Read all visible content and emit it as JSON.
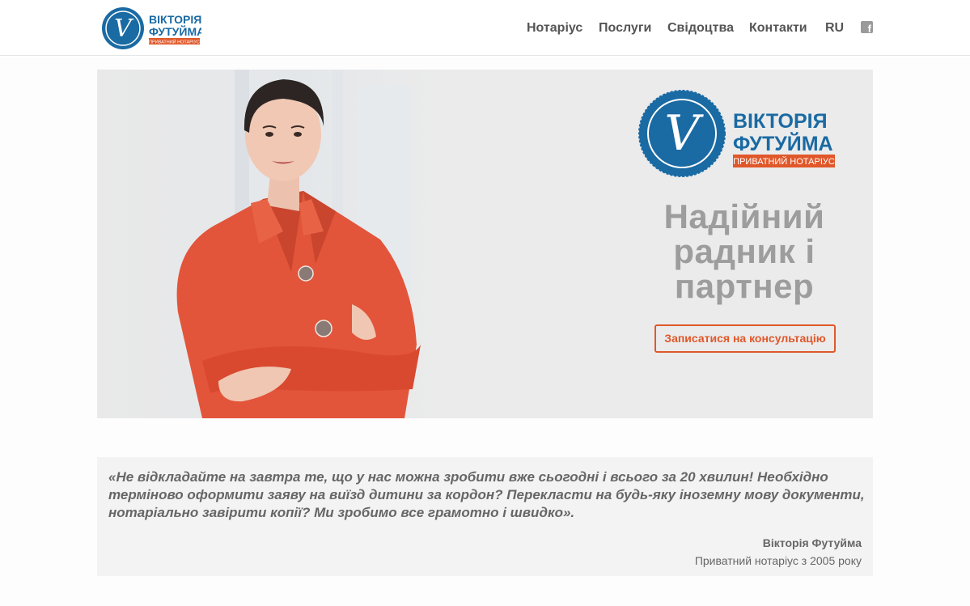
{
  "brand": {
    "name_line1": "ВІКТОРІЯ",
    "name_line2": "ФУТУЙМА",
    "tagline": "ПРИВАТНИЙ НОТАРІУС",
    "monogram": "V",
    "blue": "#1a6aa3",
    "orange": "#e0582a"
  },
  "nav": {
    "items": [
      {
        "label": "Нотаріус"
      },
      {
        "label": "Послуги"
      },
      {
        "label": "Свідоцтва"
      },
      {
        "label": "Контакти"
      },
      {
        "label": "RU"
      }
    ],
    "social_icon": "facebook-icon",
    "social_glyph": "f"
  },
  "hero": {
    "title_lines": [
      "Надійний",
      "радник і",
      "партнер"
    ],
    "cta_label": "Записатися на консультацію"
  },
  "quote": {
    "text": "«Не відкладайте на завтра те, що у нас можна зробити вже сьогодні і всього за 20 хвилин! Необхідно терміново оформити заяву на виїзд дитини за кордон? Перекласти на будь-яку іноземну мову документи, нотаріально завірити копії? Ми зробимо все грамотно і швидко».",
    "author": "Вікторія Футуйма",
    "role": "Приватний нотаріус з 2005 року"
  }
}
